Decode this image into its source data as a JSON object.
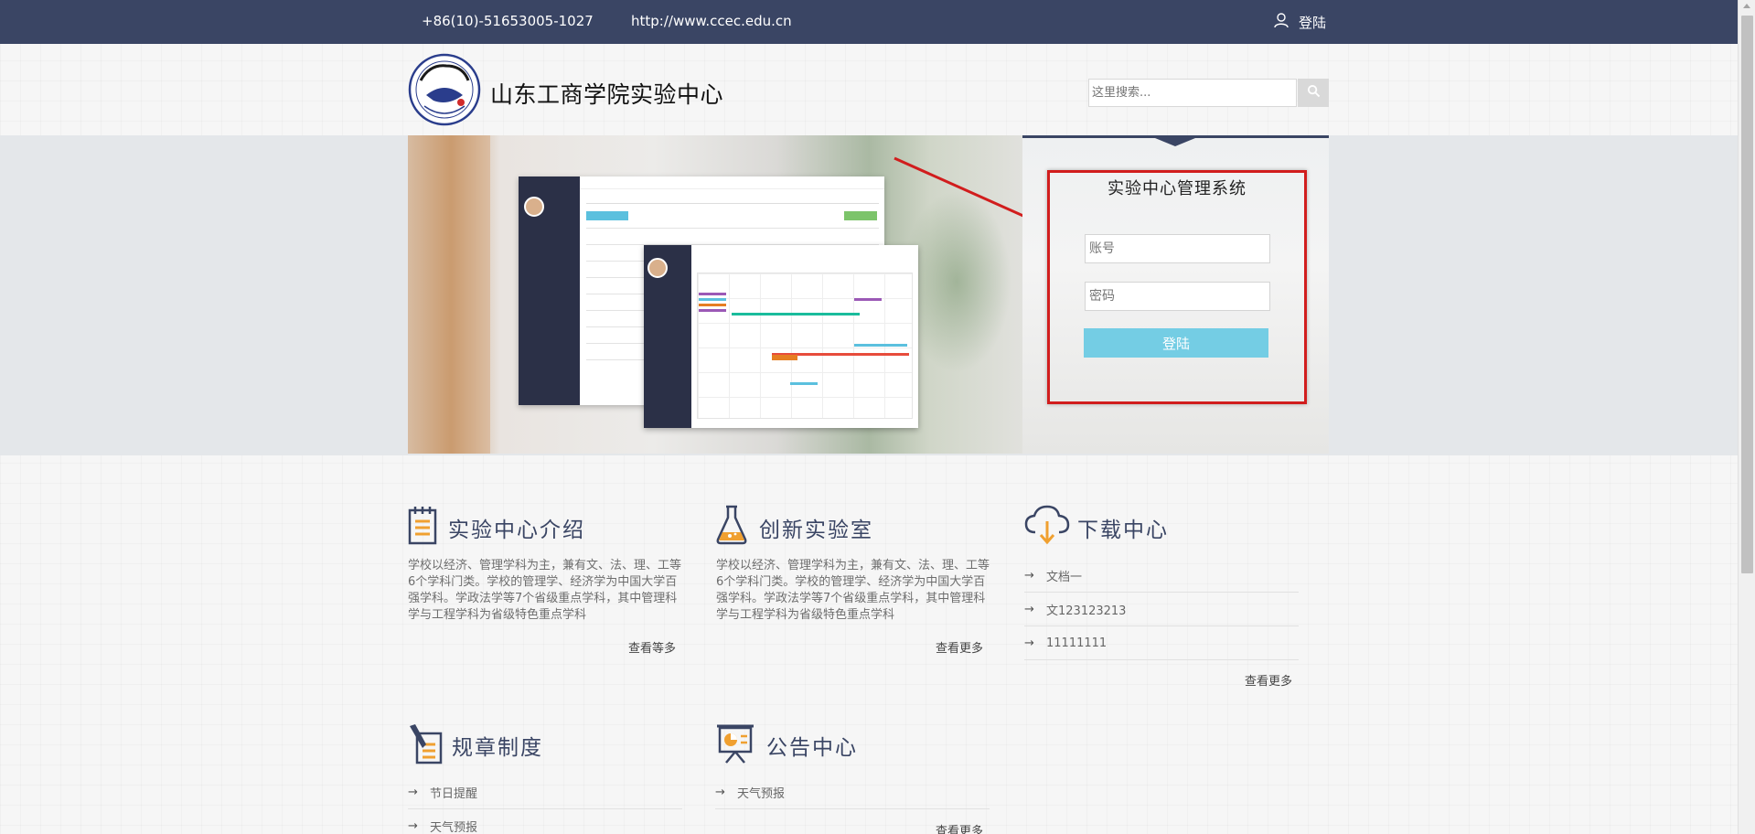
{
  "topbar": {
    "phone": "+86(10)-51653005-1027",
    "url": "http://www.ccec.edu.cn",
    "login": "登陆",
    "login_icon": "user-icon"
  },
  "header": {
    "logo": "college-seal-logo",
    "title": "山东工商学院实验中心",
    "search_placeholder": "这里搜索...",
    "search_icon": "search-icon"
  },
  "login_panel": {
    "title": "实验中心管理系统",
    "account_placeholder": "账号",
    "password_placeholder": "密码",
    "login_button": "登陆"
  },
  "sections": {
    "intro": {
      "title": "实验中心介绍",
      "icon": "notepad-icon",
      "text": "学校以经济、管理学科为主，兼有文、法、理、工等6个学科门类。学校的管理学、经济学为中国大学百强学科。学政法学等7个省级重点学科，其中管理科学与工程学科为省级特色重点学科",
      "more": "查看等多"
    },
    "lab": {
      "title": "创新实验室",
      "icon": "flask-icon",
      "text": "学校以经济、管理学科为主，兼有文、法、理、工等6个学科门类。学校的管理学、经济学为中国大学百强学科。学政法学等7个省级重点学科，其中管理科学与工程学科为省级特色重点学科",
      "more": "查看更多"
    },
    "download": {
      "title": "下载中心",
      "icon": "cloud-download-icon",
      "items": [
        "文档一",
        "文123123213",
        "11111111"
      ],
      "more": "查看更多"
    },
    "rules": {
      "title": "规章制度",
      "icon": "pen-document-icon",
      "items": [
        "节日提醒",
        "天气预报"
      ]
    },
    "notice": {
      "title": "公告中心",
      "icon": "presentation-board-icon",
      "items": [
        "天气预报"
      ],
      "more": "查看更多"
    }
  },
  "colors": {
    "topbar": "#3a4564",
    "accent_button": "#74cde4",
    "annotation_red": "#d11d1d",
    "section_title": "#3a4564",
    "icon_orange": "#f0a030"
  }
}
